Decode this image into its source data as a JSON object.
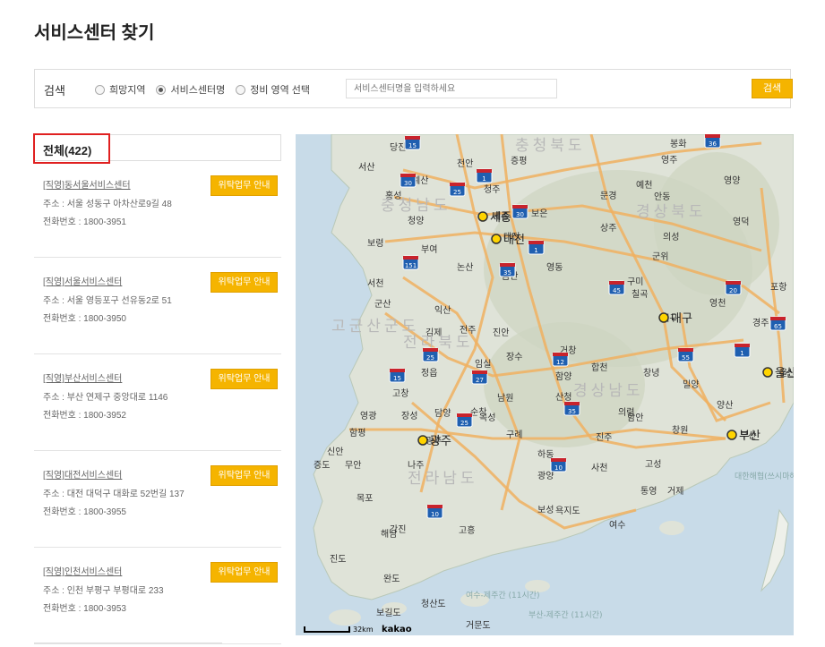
{
  "page": {
    "title": "서비스센터 찾기"
  },
  "search": {
    "label": "검색",
    "options": [
      "희망지역",
      "서비스센터명",
      "정비 영역 선택"
    ],
    "selected_index": 1,
    "placeholder": "서비스센터명을 입력하세요",
    "button_label": "검색"
  },
  "list": {
    "header": "전체(422)",
    "items": [
      {
        "name": "[직영]동서울서비스센터",
        "address": "주소 : 서울 성동구 아차산로9길 48",
        "phone": "전화번호 : 1800-3951",
        "button": "위탁업무 안내"
      },
      {
        "name": "[직영]서울서비스센터",
        "address": "주소 : 서울 영등포구 선유동2로 51",
        "phone": "전화번호 : 1800-3950",
        "button": "위탁업무 안내"
      },
      {
        "name": "[직영]부산서비스센터",
        "address": "주소 : 부산 연제구 중앙대로 1146",
        "phone": "전화번호 : 1800-3952",
        "button": "위탁업무 안내"
      },
      {
        "name": "[직영]대전서비스센터",
        "address": "주소 : 대전 대덕구 대화로 52번길 137",
        "phone": "전화번호 : 1800-3955",
        "button": "위탁업무 안내"
      },
      {
        "name": "[직영]인천서비스센터",
        "address": "주소 : 인천 부평구 부평대로 233",
        "phone": "전화번호 : 1800-3953",
        "button": "위탁업무 안내"
      }
    ]
  },
  "map": {
    "scale_label": "32km",
    "brand": "kakao",
    "land_color": "#dfe3d8",
    "sea_color": "#c8dbe8",
    "road_color": "#f0b060",
    "labels": [
      {
        "text": "당진"
      },
      {
        "text": "천안"
      },
      {
        "text": "충청북도"
      },
      {
        "text": "봉화"
      },
      {
        "text": "영주"
      },
      {
        "text": "서산"
      },
      {
        "text": "예산"
      },
      {
        "text": "증평"
      },
      {
        "text": "영양"
      },
      {
        "text": "홍성"
      },
      {
        "text": "충청남도"
      },
      {
        "text": "청주"
      },
      {
        "text": "문경"
      },
      {
        "text": "예천"
      },
      {
        "text": "안동"
      },
      {
        "text": "청양"
      },
      {
        "text": "세종"
      },
      {
        "text": "보은"
      },
      {
        "text": "경상북도"
      },
      {
        "text": "영덕"
      },
      {
        "text": "보령"
      },
      {
        "text": "대전"
      },
      {
        "text": "상주"
      },
      {
        "text": "의성"
      },
      {
        "text": "부여"
      },
      {
        "text": "논산"
      },
      {
        "text": "영동"
      },
      {
        "text": "군위"
      },
      {
        "text": "서천"
      },
      {
        "text": "금산"
      },
      {
        "text": "구미"
      },
      {
        "text": "칠곡"
      },
      {
        "text": "포항"
      },
      {
        "text": "군산"
      },
      {
        "text": "익산"
      },
      {
        "text": "영천"
      },
      {
        "text": "김제"
      },
      {
        "text": "전주"
      },
      {
        "text": "진안"
      },
      {
        "text": "대구"
      },
      {
        "text": "경주"
      },
      {
        "text": "고군산군도"
      },
      {
        "text": "전라북도"
      },
      {
        "text": "거창"
      },
      {
        "text": "정읍"
      },
      {
        "text": "임실"
      },
      {
        "text": "장수"
      },
      {
        "text": "함양"
      },
      {
        "text": "합천"
      },
      {
        "text": "창녕"
      },
      {
        "text": "밀양"
      },
      {
        "text": "울산"
      },
      {
        "text": "고창"
      },
      {
        "text": "남원"
      },
      {
        "text": "산청"
      },
      {
        "text": "경상남도"
      },
      {
        "text": "영광"
      },
      {
        "text": "장성"
      },
      {
        "text": "담양"
      },
      {
        "text": "순창"
      },
      {
        "text": "곡성"
      },
      {
        "text": "의령"
      },
      {
        "text": "함안"
      },
      {
        "text": "양산"
      },
      {
        "text": "광주"
      },
      {
        "text": "구례"
      },
      {
        "text": "진주"
      },
      {
        "text": "창원"
      },
      {
        "text": "부산"
      },
      {
        "text": "신안"
      },
      {
        "text": "함평"
      },
      {
        "text": "하동"
      },
      {
        "text": "증도"
      },
      {
        "text": "무안"
      },
      {
        "text": "나주"
      },
      {
        "text": "전라남도"
      },
      {
        "text": "광양"
      },
      {
        "text": "사천"
      },
      {
        "text": "고성"
      },
      {
        "text": "목포"
      },
      {
        "text": "통영"
      },
      {
        "text": "거제"
      },
      {
        "text": "보성"
      },
      {
        "text": "여수"
      },
      {
        "text": "욕지도"
      },
      {
        "text": "해남"
      },
      {
        "text": "강진"
      },
      {
        "text": "고흥"
      },
      {
        "text": "진도"
      },
      {
        "text": "완도"
      },
      {
        "text": "청산도"
      },
      {
        "text": "보길도"
      },
      {
        "text": "거문도"
      },
      {
        "text": "여수-제주간 (11시간)"
      },
      {
        "text": "부산-제주간 (11시간)"
      },
      {
        "text": "대한해협(쓰시마해협)"
      }
    ],
    "markers": [
      {
        "text": "세종"
      },
      {
        "text": "대전"
      },
      {
        "text": "대구"
      },
      {
        "text": "울산"
      },
      {
        "text": "광주"
      },
      {
        "text": "부산"
      }
    ],
    "shields": [
      {
        "text": "15"
      },
      {
        "text": "36"
      },
      {
        "text": "30"
      },
      {
        "text": "25"
      },
      {
        "text": "1"
      },
      {
        "text": "30"
      },
      {
        "text": "1"
      },
      {
        "text": "151"
      },
      {
        "text": "35"
      },
      {
        "text": "45"
      },
      {
        "text": "20"
      },
      {
        "text": "65"
      },
      {
        "text": "25"
      },
      {
        "text": "27"
      },
      {
        "text": "12"
      },
      {
        "text": "55"
      },
      {
        "text": "1"
      },
      {
        "text": "15"
      },
      {
        "text": "25"
      },
      {
        "text": "35"
      },
      {
        "text": "10"
      },
      {
        "text": "10"
      }
    ]
  }
}
